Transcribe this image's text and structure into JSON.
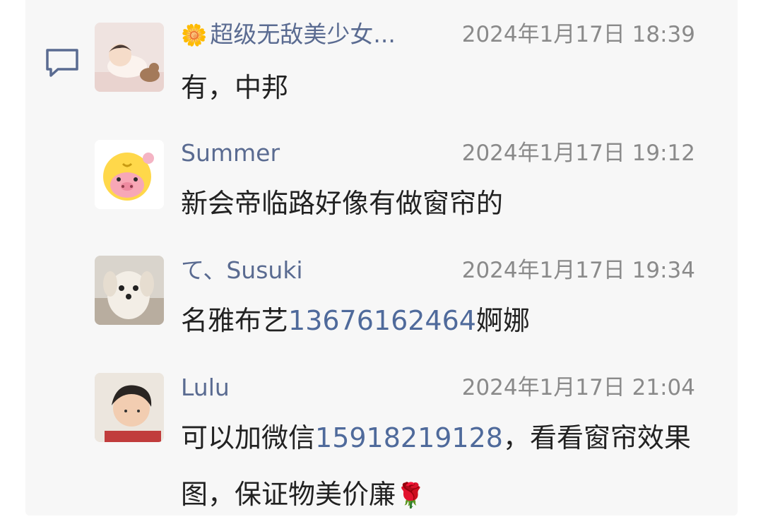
{
  "comments": [
    {
      "author": "超级无敌美少女...",
      "author_prefix_icon": "sunflower",
      "time": "2024年1月17日 18:39",
      "text": "有，中邦"
    },
    {
      "author": "Summer",
      "time": "2024年1月17日 19:12",
      "text": "新会帝临路好像有做窗帘的"
    },
    {
      "author": "て、Susuki",
      "time": "2024年1月17日 19:34",
      "text_before": "名雅布艺",
      "phone": "13676162464",
      "text_after": "婀娜"
    },
    {
      "author": "Lulu",
      "time": "2024年1月17日 21:04",
      "text_before": "可以加微信",
      "phone": "15918219128",
      "text_after": "，看看窗帘效果图，保证物美价廉",
      "trailing_emoji": "rose"
    }
  ],
  "colors": {
    "link": "#4f6a9b",
    "author": "#5a6b91",
    "timestamp": "#8a8a8a",
    "panel_bg": "#f7f7f7"
  }
}
